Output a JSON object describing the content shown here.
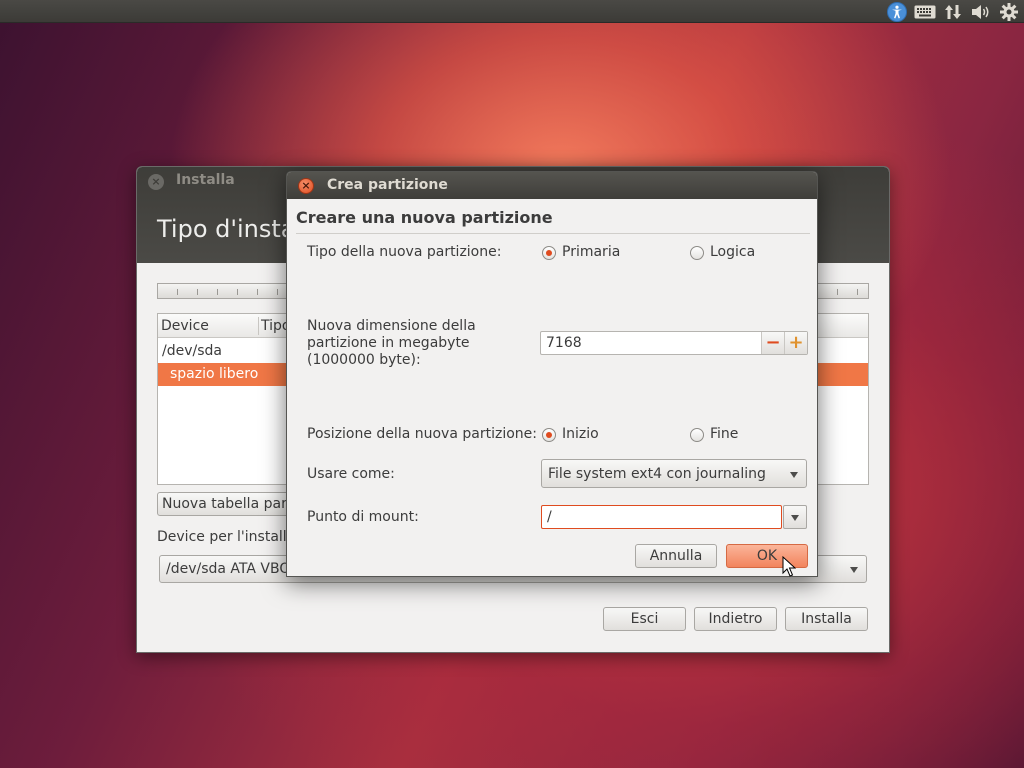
{
  "top_panel": {
    "indicators": [
      {
        "icon": "accessibility-icon",
        "active": true
      },
      {
        "icon": "keyboard-icon"
      },
      {
        "icon": "network-icon"
      },
      {
        "icon": "volume-icon"
      },
      {
        "icon": "gear-icon"
      }
    ]
  },
  "main_window": {
    "title": "Installa",
    "heading": "Tipo d'installazione",
    "table": {
      "columns": [
        "Device",
        "Tipo"
      ],
      "rows": [
        {
          "device": "/dev/sda",
          "selected": false
        },
        {
          "device": "spazio libero",
          "selected": true
        }
      ]
    },
    "new_table_button": "Nuova tabella partizioni...",
    "device_label": "Device per l'installazione del boot loader:",
    "device_value": "/dev/sda  ATA VBOX HARDDISK",
    "buttons": {
      "quit": "Esci",
      "back": "Indietro",
      "install": "Installa"
    }
  },
  "dialog": {
    "title": "Crea partizione",
    "heading": "Creare una nuova partizione",
    "type_label": "Tipo della nuova partizione:",
    "type_options": [
      "Primaria",
      "Logica"
    ],
    "type_selected": "Primaria",
    "size_label_lines": [
      "Nuova dimensione della",
      "partizione in megabyte",
      "(1000000 byte):"
    ],
    "size_value": "7168",
    "position_label": "Posizione della nuova partizione:",
    "position_options": [
      "Inizio",
      "Fine"
    ],
    "position_selected": "Inizio",
    "use_as_label": "Usare come:",
    "use_as_value": "File system ext4 con journaling",
    "mount_label": "Punto di mount:",
    "mount_value": "/",
    "cancel": "Annulla",
    "ok": "OK"
  },
  "colors": {
    "accent": "#df4b1f",
    "selection": "#f07746",
    "panel": "#3c3b37"
  }
}
